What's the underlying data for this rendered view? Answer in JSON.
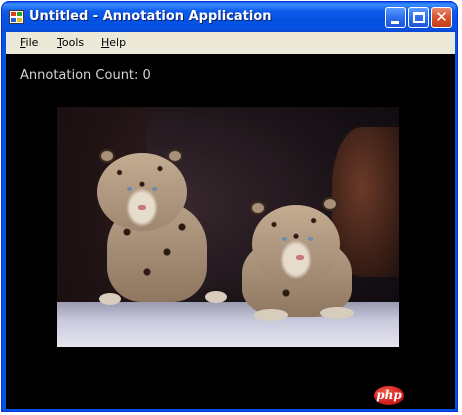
{
  "window": {
    "title": "Untitled - Annotation Application",
    "controls": {
      "minimize": "minimize",
      "maximize": "maximize",
      "close": "✕"
    }
  },
  "menu": [
    {
      "key": "F",
      "rest": "ile"
    },
    {
      "key": "T",
      "rest": "ools"
    },
    {
      "key": "H",
      "rest": "elp"
    }
  ],
  "main": {
    "annotation_count_label": "Annotation Count: 0"
  },
  "image": {
    "subject": "two leopard cubs photo"
  },
  "watermark": {
    "text": "php"
  },
  "colors": {
    "titlebar": "#0054e3",
    "menubar": "#ece9d8",
    "client_bg": "#000000",
    "label_text": "#d4d4d4",
    "close_button": "#d7532a"
  }
}
